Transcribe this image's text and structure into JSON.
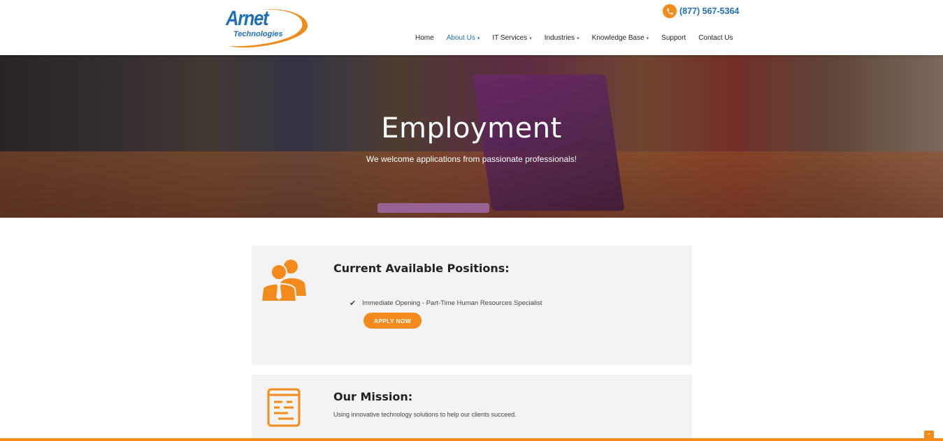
{
  "brand": {
    "name": "Arnet",
    "tagline": "Technologies"
  },
  "phone": {
    "icon": "phone-icon",
    "number": "(877) 567-5364"
  },
  "nav": {
    "items": [
      {
        "label": "Home",
        "has_caret": false,
        "active": false
      },
      {
        "label": "About Us",
        "has_caret": true,
        "active": true
      },
      {
        "label": "IT Services",
        "has_caret": true,
        "active": false
      },
      {
        "label": "Industries",
        "has_caret": true,
        "active": false
      },
      {
        "label": "Knowledge Base",
        "has_caret": true,
        "active": false
      },
      {
        "label": "Support",
        "has_caret": false,
        "active": false
      },
      {
        "label": "Contact Us",
        "has_caret": false,
        "active": false
      }
    ],
    "caret": "▾"
  },
  "hero": {
    "title": "Employment",
    "subtitle": "We welcome applications from passionate professionals!"
  },
  "positions": {
    "icon": "users-icon",
    "title": "Current Available Positions:",
    "item": "Immediate Opening - Part-Time Human Resources Specialist",
    "check_glyph": "✔",
    "apply_label": "APPLY NOW"
  },
  "mission": {
    "icon": "checklist-icon",
    "title": "Our Mission:",
    "text": "Using innovative technology solutions to help our clients succeed."
  },
  "scroll_top_glyph": "⌃",
  "colors": {
    "accent_orange": "#f28a1c",
    "brand_blue": "#1e6fb8",
    "card_bg": "#f3f3f3"
  }
}
